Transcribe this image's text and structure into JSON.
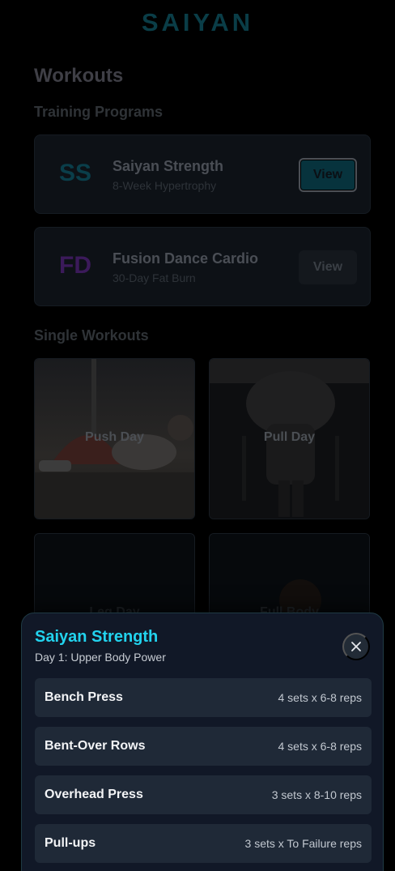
{
  "app": {
    "brand": "SAIYAN"
  },
  "page": {
    "title": "Workouts"
  },
  "programs": {
    "section_title": "Training Programs",
    "items": [
      {
        "badge": "SS",
        "badge_color": "#0a3e4a",
        "title": "Saiyan Strength",
        "subtitle": "8-Week Hypertrophy",
        "button": "View",
        "button_style": "primary"
      },
      {
        "badge": "FD",
        "badge_color": "#3b1a5a",
        "title": "Fusion Dance Cardio",
        "subtitle": "30-Day Fat Burn",
        "button": "View",
        "button_style": "secondary"
      }
    ]
  },
  "workouts": {
    "section_title": "Single Workouts",
    "items": [
      {
        "label": "Push Day"
      },
      {
        "label": "Pull Day"
      },
      {
        "label": "Leg Day"
      },
      {
        "label": "Full Body"
      }
    ]
  },
  "sheet": {
    "title": "Saiyan Strength",
    "subtitle": "Day 1: Upper Body Power",
    "close_icon": "close-icon",
    "exercises": [
      {
        "name": "Bench Press",
        "detail": "4 sets x 6-8 reps"
      },
      {
        "name": "Bent-Over Rows",
        "detail": "4 sets x 6-8 reps"
      },
      {
        "name": "Overhead Press",
        "detail": "3 sets x 8-10 reps"
      },
      {
        "name": "Pull-ups",
        "detail": "3 sets x To Failure reps"
      }
    ]
  },
  "colors": {
    "accent": "#22d3ee",
    "sheet_bg": "#111827",
    "row_bg": "#1f2937"
  }
}
